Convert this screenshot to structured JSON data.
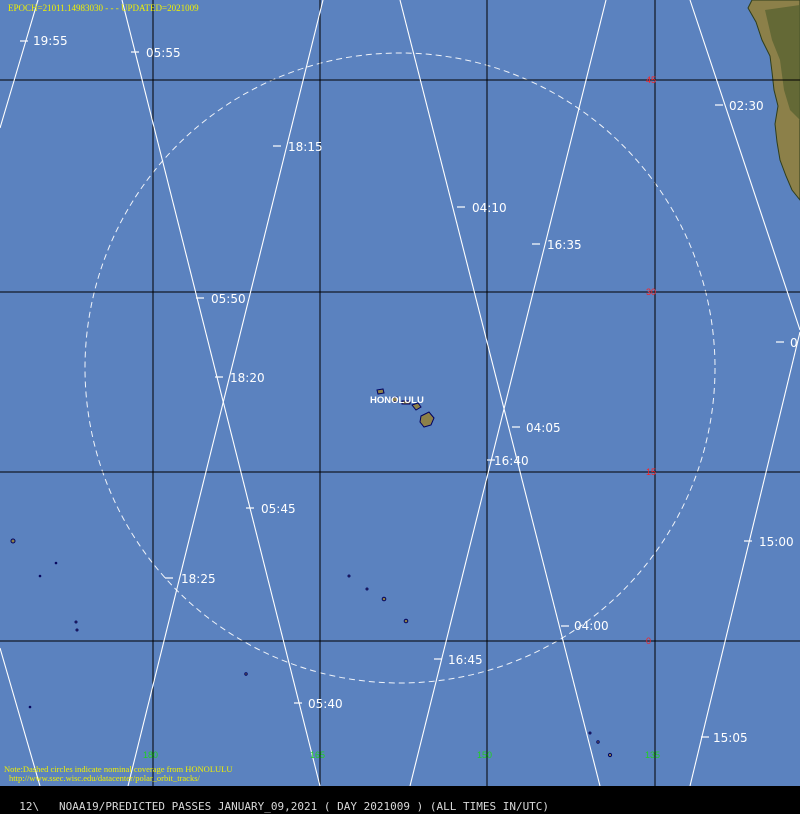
{
  "header": {
    "epoch": "EPOCH=21011.14983030",
    "separator": "- - -",
    "updated": "UPDATED=2021009"
  },
  "city": "HONOLULU",
  "lat_labels": [
    "45",
    "30",
    "15",
    "0"
  ],
  "lon_labels": [
    "180",
    "165",
    "150",
    "135"
  ],
  "time_labels": [
    "19:55",
    "05:55",
    "02:30",
    "18:15",
    "04:10",
    "16:35",
    "05:50",
    "0",
    "18:20",
    "04:05",
    "16:40",
    "05:45",
    "15:00",
    "18:25",
    "04:00",
    "16:45",
    "05:40",
    "15:05"
  ],
  "note": {
    "line1": "Note:Dashed circles indicate nominal coverage from HONOLULU",
    "line2": "http://www.ssec.wisc.edu/datacenter/polar_orbit_tracks/"
  },
  "footer": {
    "text": "12\\   NOAA19/PREDICTED PASSES JANUARY_09,2021 ( DAY 2021009 ) (ALL TIMES IN/UTC)"
  },
  "colors": {
    "ocean": "#5b82bf",
    "grid": "#000000",
    "track": "#ffffff",
    "land": "#8c8049",
    "island_outline": "#000060",
    "lat_label": "#ff2020",
    "lon_label": "#20d020",
    "header_text": "#f0f000"
  }
}
